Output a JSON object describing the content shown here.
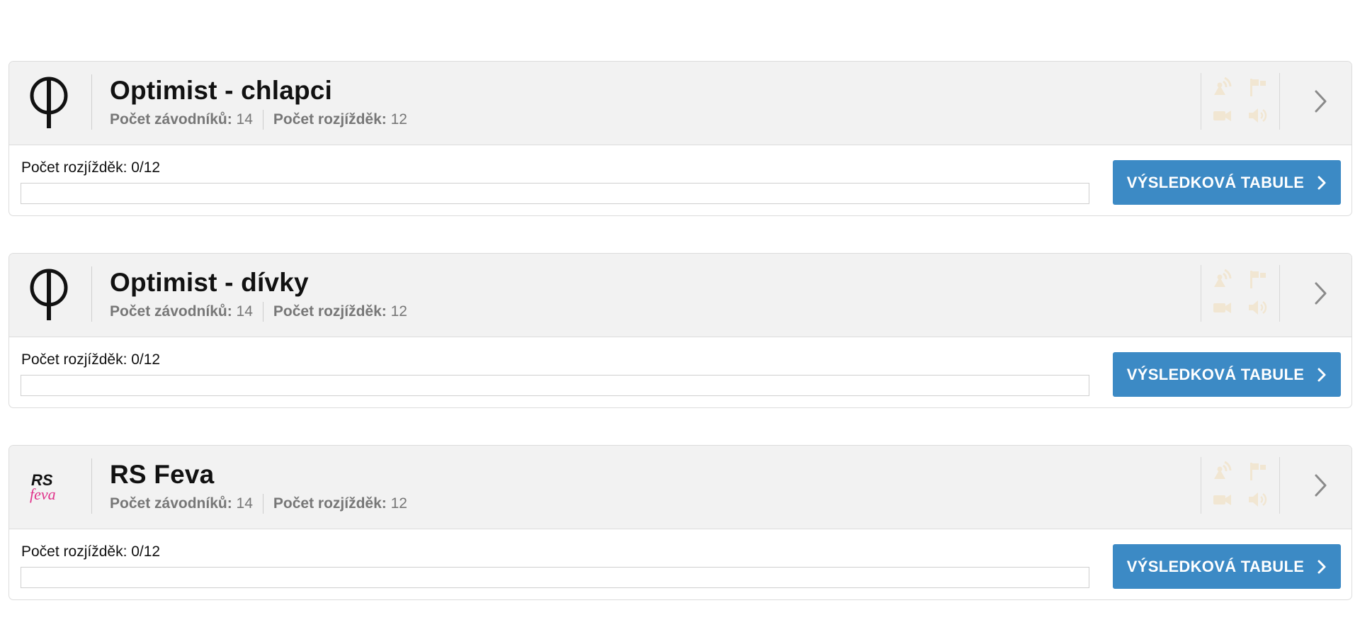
{
  "classes": [
    {
      "name": "Optimist - chlapci",
      "logo": "optimist-logo",
      "competitors_label": "Počet závodníků:",
      "competitors_value": "14",
      "races_label": "Počet rozjížděk:",
      "races_value": "12",
      "progress_text": "Počet rozjížděk: 0/12",
      "progress": 0,
      "features": [
        "live-broadcast-icon",
        "flag-icon",
        "video-camera-icon",
        "speaker-icon"
      ],
      "results_button": "VÝSLEDKOVÁ TABULE"
    },
    {
      "name": "Optimist - dívky",
      "logo": "optimist-logo",
      "competitors_label": "Počet závodníků:",
      "competitors_value": "14",
      "races_label": "Počet rozjížděk:",
      "races_value": "12",
      "progress_text": "Počet rozjížděk: 0/12",
      "progress": 0,
      "features": [
        "live-broadcast-icon",
        "flag-icon",
        "video-camera-icon",
        "speaker-icon"
      ],
      "results_button": "VÝSLEDKOVÁ TABULE"
    },
    {
      "name": "RS Feva",
      "logo": "rs-feva-logo",
      "logo_text_top": "RS",
      "logo_text_bottom": "feva",
      "competitors_label": "Počet závodníků:",
      "competitors_value": "14",
      "races_label": "Počet rozjížděk:",
      "races_value": "12",
      "progress_text": "Počet rozjížděk: 0/12",
      "progress": 0,
      "features": [
        "live-broadcast-icon",
        "flag-icon",
        "video-camera-icon",
        "speaker-icon"
      ],
      "results_button": "VÝSLEDKOVÁ TABULE"
    }
  ],
  "colors": {
    "button": "#3c8ac5",
    "header_bg": "#f2f2f2",
    "feature_icon_disabled": "#f1e6d2",
    "muted_text": "#777777"
  }
}
